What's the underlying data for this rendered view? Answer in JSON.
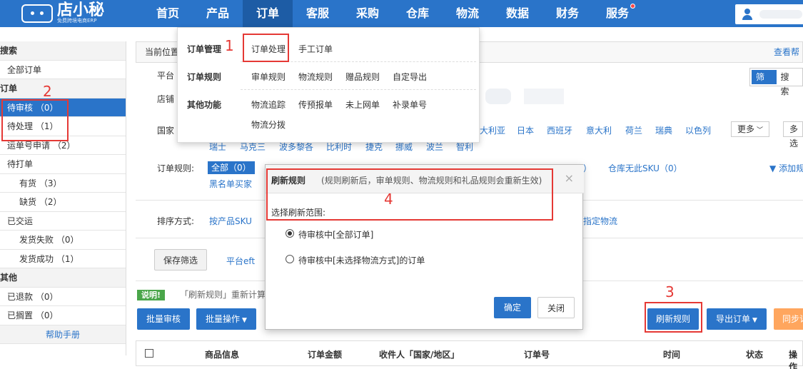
{
  "logo": {
    "name": "店小秘",
    "tagline": "免费跨境电商ERP"
  },
  "nav": [
    {
      "label": "首页"
    },
    {
      "label": "产品"
    },
    {
      "label": "订单"
    },
    {
      "label": "客服"
    },
    {
      "label": "采购"
    },
    {
      "label": "仓库"
    },
    {
      "label": "物流"
    },
    {
      "label": "数据"
    },
    {
      "label": "财务"
    },
    {
      "label": "服务"
    }
  ],
  "sidebar": {
    "search_head": "搜索",
    "all_orders": "全部订单",
    "order_head": "订单",
    "pending_review": "待审核 （0）",
    "pending_process": "待处理 （1）",
    "waybill_apply": "运单号申请 （2）",
    "to_print": "待打单",
    "in_stock": "有货 （3）",
    "out_of_stock": "缺货 （2）",
    "shipped": "已交运",
    "ship_fail": "发货失败 （0）",
    "ship_success": "发货成功 （1）",
    "other_head": "其他",
    "refunded": "已退款 （0）",
    "on_hold": "已搁置 （0）",
    "help": "帮助手册"
  },
  "breadcrumb": {
    "label": "当前位置",
    "help_link": "查看帮"
  },
  "filters": {
    "platform": "平台",
    "store": "店铺",
    "country": "国家",
    "countries_row1": [
      "大利亚",
      "日本",
      "西班牙",
      "意大利",
      "荷兰",
      "瑞典",
      "以色列"
    ],
    "countries_row2": [
      "瑞士",
      "马克三",
      "波多黎各",
      "比利时",
      "捷克",
      "挪威",
      "波兰",
      "智利"
    ],
    "more": "更多",
    "more2": "多选",
    "order_rules_label": "订单规则:",
    "order_rules_all": "全部（0）",
    "blacklist": "黑名单买家",
    "no_sku": "仓库无此SKU（0）",
    "add_rule": "添加规",
    "paren_close": "）",
    "sort_label": "排序方式:",
    "sort_by_sku": "按产品SKU",
    "sort_by_logistics": "按指定物流",
    "save_filter": "保存筛选",
    "platform_sort": "平台eft"
  },
  "tabs": [
    "筛选",
    "搜索"
  ],
  "tip": {
    "badge": "说明!",
    "text": "「刷新规则」重新计算"
  },
  "actions": {
    "batch_review": "批量审核",
    "batch_ops": "批量操作",
    "refresh_rules": "刷新规则",
    "export_orders": "导出订单",
    "sync": "同步订"
  },
  "table_headers": [
    "商品信息",
    "订单金额",
    "收件人「国家/地区」",
    "订单号",
    "时间",
    "状态",
    "操作"
  ],
  "dropdown": {
    "order_mgmt": "订单管理",
    "order_process": "订单处理",
    "manual_order": "手工订单",
    "order_rules": "订单规则",
    "review_rules": "审单规则",
    "logistics_rules": "物流规则",
    "gift_rules": "赠品规则",
    "custom_export": "自定导出",
    "other_funcs": "其他功能",
    "logistics_track": "物流追踪",
    "pre_declare": "传预报单",
    "not_online": "未上网单",
    "add_tracking": "补录单号",
    "logistics_split": "物流分拨"
  },
  "modal": {
    "title": "刷新规则",
    "note": "(规则刷新后，审单规则、物流规则和礼品规则会重新生效)",
    "scope_label": "选择刷新范围:",
    "option1": "待审核中[全部订单]",
    "option2": "待审核中[未选择物流方式]的订单",
    "confirm": "确定",
    "close": "关闭",
    "close_icon": "×"
  },
  "annotations": [
    "1",
    "2",
    "3",
    "4"
  ],
  "colors": {
    "primary": "#2a74c9",
    "annotation": "#e53935",
    "orange": "#ffa65e",
    "green": "#4aa64a"
  }
}
